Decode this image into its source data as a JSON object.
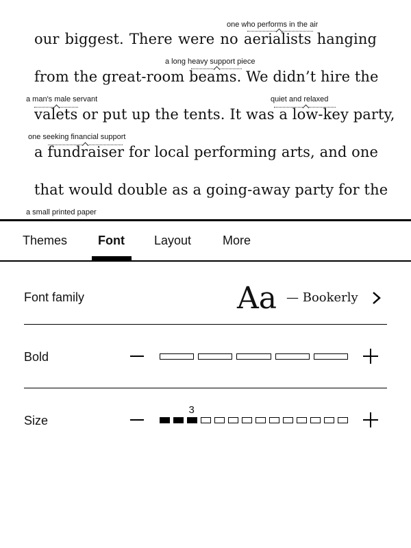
{
  "book": {
    "lines": [
      "our biggest. There were no aerialists hanging",
      "from the great-room beams. We didn’t hire the",
      "valets or put up the tents. It was a low-key party,",
      "a fundraiser for local performing arts, and one",
      "that would double as a going-away party for the"
    ],
    "glosses": [
      {
        "word": "aerialists",
        "definition": "one who performs in the air"
      },
      {
        "word": "beams",
        "definition": "a long heavy support piece"
      },
      {
        "word": "valets",
        "definition": "a man's male servant"
      },
      {
        "word": "low-key",
        "definition": "quiet and relaxed"
      },
      {
        "word": "fundraiser",
        "definition": "one seeking financial support"
      },
      {
        "word": "",
        "definition": "a small printed paper"
      }
    ]
  },
  "tabs": [
    {
      "label": "Themes",
      "active": false
    },
    {
      "label": "Font",
      "active": true
    },
    {
      "label": "Layout",
      "active": false
    },
    {
      "label": "More",
      "active": false
    }
  ],
  "font_panel": {
    "font_family": {
      "label": "Font family",
      "sample": "Aa",
      "value": "— Bookerly"
    },
    "bold": {
      "label": "Bold",
      "level": 0,
      "steps": 5
    },
    "size": {
      "label": "Size",
      "level": 3,
      "steps": 14,
      "value_label": "3"
    }
  }
}
